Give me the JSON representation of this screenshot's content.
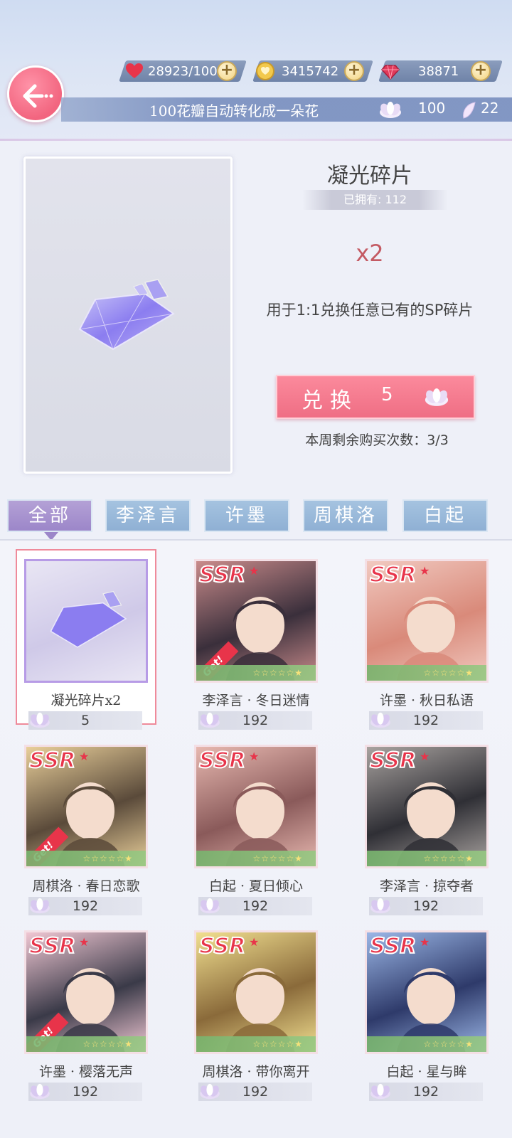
{
  "header": {
    "hearts": "28923/100",
    "gold": "3415742",
    "diamonds": "38871",
    "banner_text": "100花瓣自动转化成一朵花",
    "flowers": "100",
    "petals": "22"
  },
  "item": {
    "title": "凝光碎片",
    "owned": "已拥有: 112",
    "quantity": "x2",
    "description": "用于1:1兑换任意已有的SP碎片",
    "exchange_label": "兑换",
    "exchange_cost": "5",
    "remaining": "本周剩余购买次数：3/3"
  },
  "tabs": [
    {
      "label": "全部",
      "active": true
    },
    {
      "label": "李泽言",
      "active": false
    },
    {
      "label": "许墨",
      "active": false
    },
    {
      "label": "周棋洛",
      "active": false
    },
    {
      "label": "白起",
      "active": false
    }
  ],
  "cards": [
    {
      "name": "凝光碎片x2",
      "price": "5",
      "rarity": "",
      "get": false
    },
    {
      "name": "李泽言 · 冬日迷情",
      "price": "192",
      "rarity": "SSR",
      "get": true
    },
    {
      "name": "许墨 · 秋日私语",
      "price": "192",
      "rarity": "SSR",
      "get": false
    },
    {
      "name": "周棋洛 · 春日恋歌",
      "price": "192",
      "rarity": "SSR",
      "get": true
    },
    {
      "name": "白起 · 夏日倾心",
      "price": "192",
      "rarity": "SSR",
      "get": false
    },
    {
      "name": "李泽言 · 掠夺者",
      "price": "192",
      "rarity": "SSR",
      "get": false
    },
    {
      "name": "许墨 · 樱落无声",
      "price": "192",
      "rarity": "SSR",
      "get": true
    },
    {
      "name": "周棋洛 · 带你离开",
      "price": "192",
      "rarity": "SSR",
      "get": false
    },
    {
      "name": "白起 · 星与眸",
      "price": "192",
      "rarity": "SSR",
      "get": false
    }
  ],
  "colors": {
    "accent_pink": "#ef6e84",
    "tab_blue": "#8fb0d4",
    "tab_active": "#9c86c9",
    "ssr_red": "#e8344a"
  }
}
